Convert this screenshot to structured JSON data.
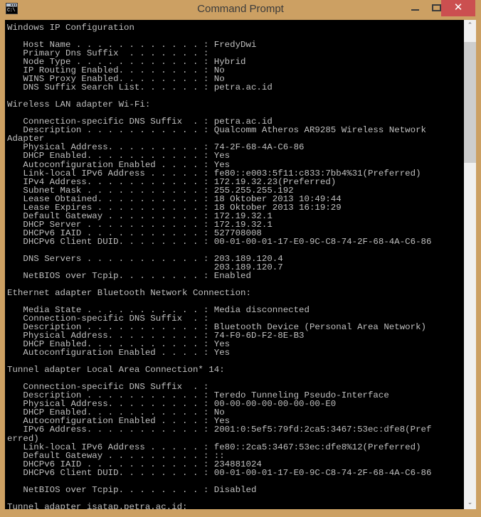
{
  "window": {
    "title": "Command Prompt",
    "icon_name": "command-prompt-icon",
    "icon_label": "C:\\",
    "titlebar_color": "#cca063",
    "close_button_color": "#cb4f50",
    "console_background": "#000000",
    "console_foreground": "#c0c0c0"
  },
  "titlebar_buttons": {
    "minimize_label": "—",
    "maximize_label": "❐",
    "close_label": "✕"
  },
  "scrollbar": {
    "up_arrow": "⌃",
    "down_arrow": "⌄"
  },
  "console": {
    "text": "Windows IP Configuration\n\n   Host Name . . . . . . . . . . . . : FredyDwi\n   Primary Dns Suffix  . . . . . . . :\n   Node Type . . . . . . . . . . . . : Hybrid\n   IP Routing Enabled. . . . . . . . : No\n   WINS Proxy Enabled. . . . . . . . : No\n   DNS Suffix Search List. . . . . . : petra.ac.id\n\nWireless LAN adapter Wi-Fi:\n\n   Connection-specific DNS Suffix  . : petra.ac.id\n   Description . . . . . . . . . . . : Qualcomm Atheros AR9285 Wireless Network\nAdapter\n   Physical Address. . . . . . . . . : 74-2F-68-4A-C6-86\n   DHCP Enabled. . . . . . . . . . . : Yes\n   Autoconfiguration Enabled . . . . : Yes\n   Link-local IPv6 Address . . . . . : fe80::e003:5f11:c833:7bb4%31(Preferred)\n   IPv4 Address. . . . . . . . . . . : 172.19.32.23(Preferred)\n   Subnet Mask . . . . . . . . . . . : 255.255.255.192\n   Lease Obtained. . . . . . . . . . : 18 Oktober 2013 10:49:44\n   Lease Expires . . . . . . . . . . : 18 Oktober 2013 16:19:29\n   Default Gateway . . . . . . . . . : 172.19.32.1\n   DHCP Server . . . . . . . . . . . : 172.19.32.1\n   DHCPv6 IAID . . . . . . . . . . . : 527708008\n   DHCPv6 Client DUID. . . . . . . . : 00-01-00-01-17-E0-9C-C8-74-2F-68-4A-C6-86\n\n   DNS Servers . . . . . . . . . . . : 203.189.120.4\n                                       203.189.120.7\n   NetBIOS over Tcpip. . . . . . . . : Enabled\n\nEthernet adapter Bluetooth Network Connection:\n\n   Media State . . . . . . . . . . . : Media disconnected\n   Connection-specific DNS Suffix  . :\n   Description . . . . . . . . . . . : Bluetooth Device (Personal Area Network)\n   Physical Address. . . . . . . . . : 74-F0-6D-F2-8E-B3\n   DHCP Enabled. . . . . . . . . . . : Yes\n   Autoconfiguration Enabled . . . . : Yes\n\nTunnel adapter Local Area Connection* 14:\n\n   Connection-specific DNS Suffix  . :\n   Description . . . . . . . . . . . : Teredo Tunneling Pseudo-Interface\n   Physical Address. . . . . . . . . : 00-00-00-00-00-00-00-E0\n   DHCP Enabled. . . . . . . . . . . : No\n   Autoconfiguration Enabled . . . . : Yes\n   IPv6 Address. . . . . . . . . . . : 2001:0:5ef5:79fd:2ca5:3467:53ec:dfe8(Pref\nerred)\n   Link-local IPv6 Address . . . . . : fe80::2ca5:3467:53ec:dfe8%12(Preferred)\n   Default Gateway . . . . . . . . . : ::\n   DHCPv6 IAID . . . . . . . . . . . : 234881024\n   DHCPv6 Client DUID. . . . . . . . : 00-01-00-01-17-E0-9C-C8-74-2F-68-4A-C6-86\n\n   NetBIOS over Tcpip. . . . . . . . : Disabled\n\nTunnel adapter isatap.petra.ac.id:"
  }
}
